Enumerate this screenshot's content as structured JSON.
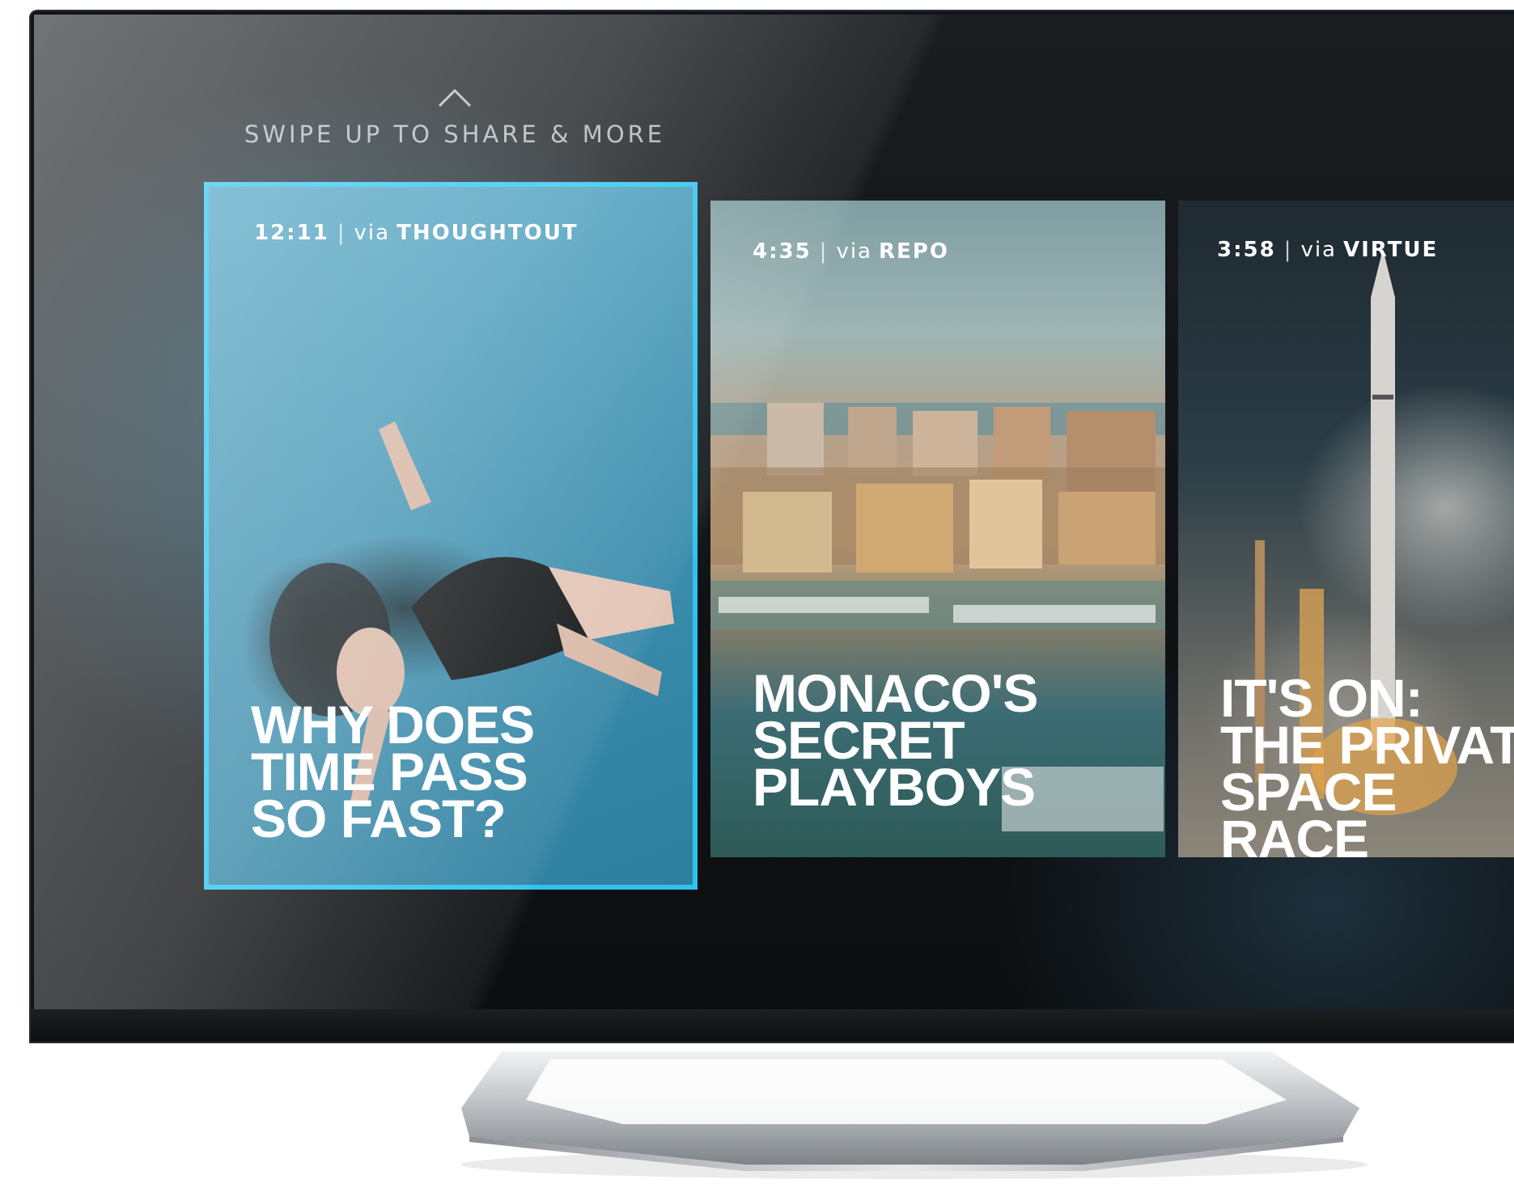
{
  "swipe_hint": {
    "icon": "chevron-up-icon",
    "text": "SWIPE UP TO SHARE & MORE"
  },
  "cards": [
    {
      "duration": "12:11",
      "separator": "|",
      "via": "via",
      "source": "THOUGHTOUT",
      "title": "WHY DOES\nTIME PASS\nSO FAST?",
      "focused": true
    },
    {
      "duration": "4:35",
      "separator": "|",
      "via": "via",
      "source": "REPO",
      "title": "MONACO'S\nSECRET\nPLAYBOYS",
      "focused": false
    },
    {
      "duration": "3:58",
      "separator": "|",
      "via": "via",
      "source": "VIRTUE",
      "title": "IT'S ON:\nTHE PRIVATI\nSPACE RACE",
      "focused": false
    }
  ],
  "colors": {
    "focus_border": "#2ec3ee"
  }
}
